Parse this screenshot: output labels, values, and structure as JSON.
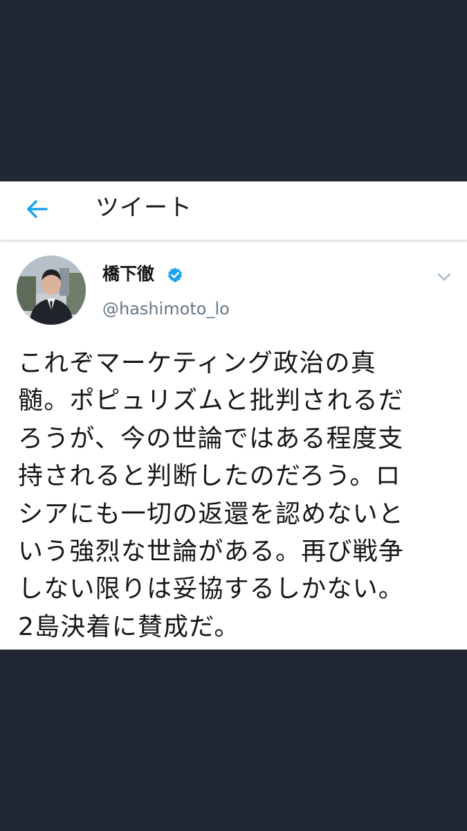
{
  "header": {
    "title": "ツイート",
    "back_icon": "arrow-left-icon"
  },
  "author": {
    "name": "橋下徹",
    "handle": "@hashimoto_lo",
    "verified_icon": "verified-badge-icon"
  },
  "menu": {
    "icon": "chevron-down-icon"
  },
  "tweet": {
    "text": "これぞマーケティング政治の真\n髄。ポピュリズムと批判されるだ\nろうが、今の世論ではある程度支\n持されると判断したのだろう。ロ\nシアにも一切の返還を認めないと\nいう強烈な世論がある。再び戦争\nしない限りは妥協するしかない。\n2島決着に賛成だ。"
  },
  "colors": {
    "accent": "#1da1f2",
    "background_dark": "#222833",
    "card": "#ffffff",
    "text_primary": "#14171a",
    "text_secondary": "#657786"
  }
}
